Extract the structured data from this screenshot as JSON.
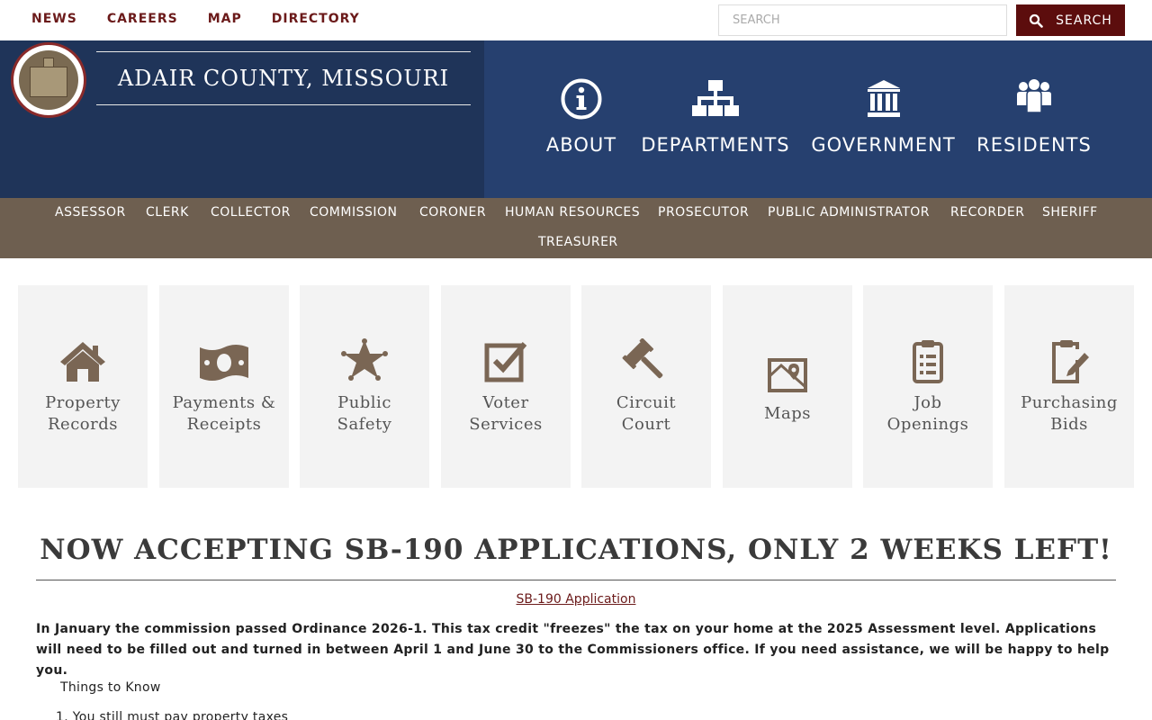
{
  "top_links": [
    "NEWS",
    "CAREERS",
    "MAP",
    "DIRECTORY"
  ],
  "search": {
    "placeholder": "SEARCH",
    "button_label": "SEARCH"
  },
  "header": {
    "site_title": "ADAIR COUNTY, MISSOURI"
  },
  "main_nav": [
    {
      "label": "ABOUT",
      "icon": "info-icon"
    },
    {
      "label": "DEPARTMENTS",
      "icon": "org-chart-icon"
    },
    {
      "label": "GOVERNMENT",
      "icon": "building-columns-icon"
    },
    {
      "label": "RESIDENTS",
      "icon": "people-icon"
    }
  ],
  "departments": [
    "ASSESSOR",
    "CLERK",
    "COLLECTOR",
    "COMMISSION",
    "CORONER",
    "HUMAN RESOURCES",
    "PROSECUTOR",
    "PUBLIC ADMINISTRATOR",
    "RECORDER",
    "SHERIFF",
    "TREASURER"
  ],
  "quick_links": [
    {
      "label": "Property\nRecords",
      "icon": "house-icon"
    },
    {
      "label": "Payments &\nReceipts",
      "icon": "money-icon"
    },
    {
      "label": "Public\nSafety",
      "icon": "sheriff-star-icon"
    },
    {
      "label": "Voter\nServices",
      "icon": "checkbox-icon"
    },
    {
      "label": "Circuit\nCourt",
      "icon": "gavel-icon"
    },
    {
      "label": "Maps",
      "icon": "map-icon"
    },
    {
      "label": "Job\nOpenings",
      "icon": "clipboard-list-icon"
    },
    {
      "label": "Purchasing\nBids",
      "icon": "clipboard-edit-icon"
    }
  ],
  "article": {
    "headline": "NOW ACCEPTING SB-190 APPLICATIONS, ONLY 2 WEEKS LEFT!",
    "link_text": "SB-190 Application",
    "body": "In January the commission passed Ordinance 2026-1.  This tax credit \"freezes\" the tax on your home at the 2025 Assessment level.  Applications will need to be filled out and turned in between April 1 and June 30 to the Commissioners office.  If you need assistance, we will be happy to help you.",
    "subheading": "Things to Know",
    "list_item_1": "1.  You still must pay property taxes"
  },
  "colors": {
    "accent": "#5c0d0d",
    "header_left": "#1f3459",
    "header_right": "#26406f",
    "dept_bar": "#6e5f50",
    "tile_bg": "#f3f3f3",
    "icon": "#7a6654"
  }
}
